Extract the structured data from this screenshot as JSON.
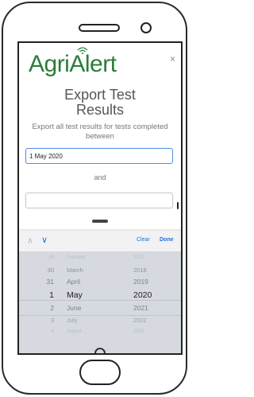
{
  "app": {
    "logo_text_agri": "Agri",
    "logo_text_alert": "Alert"
  },
  "modal": {
    "close_label": "×",
    "title_line1": "Export Test",
    "title_line2": "Results",
    "subtitle": "Export all test results for tests completed between",
    "start_date_value": "1 May 2020",
    "and_label": "and",
    "end_date_value": ""
  },
  "picker_toolbar": {
    "prev_label": "∧",
    "next_label": "∨",
    "clear_label": "Clear",
    "done_label": "Done"
  },
  "picker": {
    "days": [
      "29",
      "30",
      "31",
      "1",
      "2",
      "3",
      "4"
    ],
    "months": [
      "February",
      "March",
      "April",
      "May",
      "June",
      "July",
      "August"
    ],
    "years": [
      "2017",
      "2018",
      "2019",
      "2020",
      "2021",
      "2022",
      "2023"
    ],
    "selected": {
      "day": "1",
      "month": "May",
      "year": "2020"
    }
  },
  "colors": {
    "brand_green": "#2a7d3a",
    "accent_blue": "#1d6fe0"
  }
}
